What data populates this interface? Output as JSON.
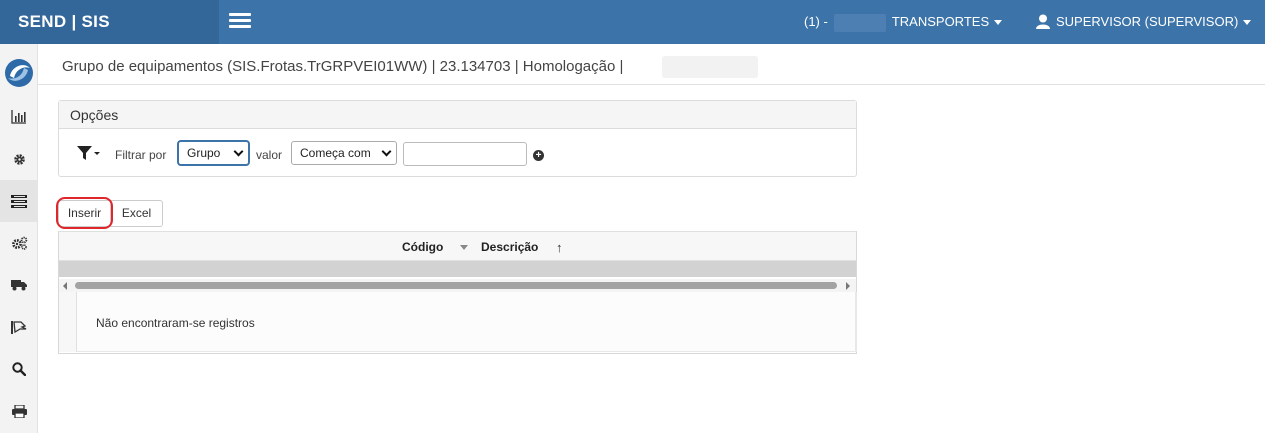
{
  "header": {
    "brand": "SEND | SIS",
    "company_prefix": "(1) -",
    "company_name": "TRANSPORTES",
    "user": "SUPERVISOR (SUPERVISOR)"
  },
  "sidebar": {
    "items": [
      "chart-icon",
      "gear-icon",
      "list-icon",
      "gears-icon",
      "truck-icon",
      "hand-icon",
      "search-icon",
      "print-icon"
    ]
  },
  "page": {
    "title": "Grupo de equipamentos (SIS.Frotas.TrGRPVEI01WW) | 23.134703 | Homologação |"
  },
  "options": {
    "title": "Opções",
    "filter_label": "Filtrar por",
    "filter_field": "Grupo",
    "value_label": "valor",
    "operator": "Começa com",
    "search_value": ""
  },
  "toolbar": {
    "insert_label": "Inserir",
    "excel_label": "Excel"
  },
  "grid": {
    "columns": [
      "Código",
      "Descrição"
    ],
    "empty_message": "Não encontraram-se registros"
  },
  "colors": {
    "topbar": "#3c73a8",
    "brand_bg": "#336699",
    "highlight": "#e0262b"
  }
}
